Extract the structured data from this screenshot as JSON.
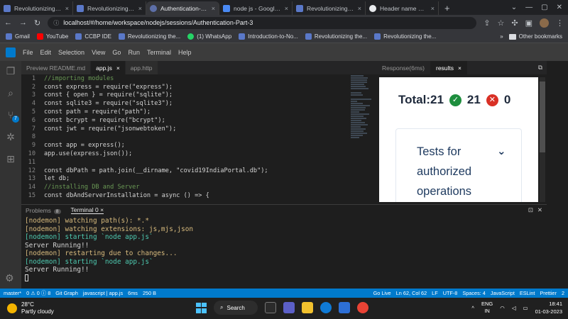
{
  "browser": {
    "tabs": [
      {
        "title": "Revolutionizing the",
        "icon": "site-icon",
        "active": false
      },
      {
        "title": "Revolutionizing the",
        "icon": "site-icon",
        "active": false
      },
      {
        "title": "Authentication-Par",
        "icon": "ccbp-icon",
        "active": true
      },
      {
        "title": "node js - Google D",
        "icon": "docs-icon",
        "active": false
      },
      {
        "title": "Revolutionizing the",
        "icon": "site-icon",
        "active": false
      },
      {
        "title": "Header name must",
        "icon": "github-icon",
        "active": false
      }
    ],
    "url": "localhost/#/home/workspace/nodejs/sessions/Authentication-Part-3",
    "bookmarks": [
      {
        "label": "Gmail",
        "icon": "gmail-icon"
      },
      {
        "label": "YouTube",
        "icon": "youtube-icon"
      },
      {
        "label": "CCBP IDE",
        "icon": "ccbp-icon"
      },
      {
        "label": "Revolutionizing the...",
        "icon": "site-icon"
      },
      {
        "label": "(1) WhatsApp",
        "icon": "whatsapp-icon"
      },
      {
        "label": "Introduction-to-No...",
        "icon": "ccbp-icon"
      },
      {
        "label": "Revolutionizing the...",
        "icon": "site-icon"
      },
      {
        "label": "Revolutionizing the...",
        "icon": "site-icon"
      }
    ],
    "other_bookmarks": "Other bookmarks"
  },
  "vscode": {
    "menu": [
      "File",
      "Edit",
      "Selection",
      "View",
      "Go",
      "Run",
      "Terminal",
      "Help"
    ],
    "editor_tabs": [
      {
        "label": "Preview README.md",
        "active": false
      },
      {
        "label": "app.js",
        "active": true,
        "close": "×"
      },
      {
        "label": "app.http",
        "active": false
      }
    ],
    "code_lines": [
      {
        "n": "1",
        "text": "//importing modules",
        "color": "#6a9955"
      },
      {
        "n": "2",
        "text": "const express = require(\"express\");",
        "color": "#d4d4d4"
      },
      {
        "n": "3",
        "text": "const { open } = require(\"sqlite\");",
        "color": "#d4d4d4"
      },
      {
        "n": "4",
        "text": "const sqlite3 = require(\"sqlite3\");",
        "color": "#d4d4d4"
      },
      {
        "n": "5",
        "text": "const path = require(\"path\");",
        "color": "#d4d4d4"
      },
      {
        "n": "6",
        "text": "const bcrypt = require(\"bcrypt\");",
        "color": "#d4d4d4"
      },
      {
        "n": "7",
        "text": "const jwt = require(\"jsonwebtoken\");",
        "color": "#d4d4d4"
      },
      {
        "n": "8",
        "text": "",
        "color": "#d4d4d4"
      },
      {
        "n": "9",
        "text": "const app = express();",
        "color": "#d4d4d4"
      },
      {
        "n": "10",
        "text": "app.use(express.json());",
        "color": "#d4d4d4"
      },
      {
        "n": "11",
        "text": "",
        "color": "#d4d4d4"
      },
      {
        "n": "12",
        "text": "const dbPath = path.join(__dirname, \"covid19IndiaPortal.db\");",
        "color": "#d4d4d4"
      },
      {
        "n": "13",
        "text": "let db;",
        "color": "#d4d4d4"
      },
      {
        "n": "14",
        "text": "//installing DB and Server",
        "color": "#6a9955"
      },
      {
        "n": "15",
        "text": "const dbAndServerInstallation = async () => {",
        "color": "#d4d4d4"
      }
    ],
    "preview_tabs": [
      {
        "label": "Response(6ms)",
        "active": false
      },
      {
        "label": "results",
        "active": true,
        "close": "×"
      }
    ],
    "results": {
      "total_label": "Total:21",
      "passed": "21",
      "failed": "0",
      "category": "Tests for authorized operations"
    },
    "panel_tabs": {
      "problems": "Problems",
      "problems_count": "8",
      "terminal": "Terminal 0",
      "close": "×"
    },
    "terminal_lines": [
      {
        "text": "[nodemon] watching path(s): *.*",
        "tone": "yellow"
      },
      {
        "text": "[nodemon] watching extensions: js,mjs,json",
        "tone": "yellow"
      },
      {
        "text": "[nodemon] starting `node app.js`",
        "tone": "green"
      },
      {
        "text": "Server Running!!",
        "tone": "white"
      },
      {
        "text": "[nodemon] restarting due to changes...",
        "tone": "yellow"
      },
      {
        "text": "[nodemon] starting `node app.js`",
        "tone": "green"
      },
      {
        "text": "Server Running!!",
        "tone": "white"
      }
    ],
    "status_left": [
      "master*",
      "0 ⚠ 0 ⓘ 8",
      "Git Graph",
      "javascript | app.js",
      "6ms",
      "250 B"
    ],
    "status_right": [
      "Go Live",
      "Ln 62, Col 62",
      "LF",
      "UTF-8",
      "Spaces: 4",
      "JavaScript",
      "ESLint",
      "Prettier",
      "2"
    ]
  },
  "taskbar": {
    "weather_temp": "28°C",
    "weather_desc": "Partly cloudy",
    "search_label": "Search",
    "lang_top": "ENG",
    "lang_bottom": "IN",
    "time": "18:41",
    "date": "01-03-2023"
  }
}
